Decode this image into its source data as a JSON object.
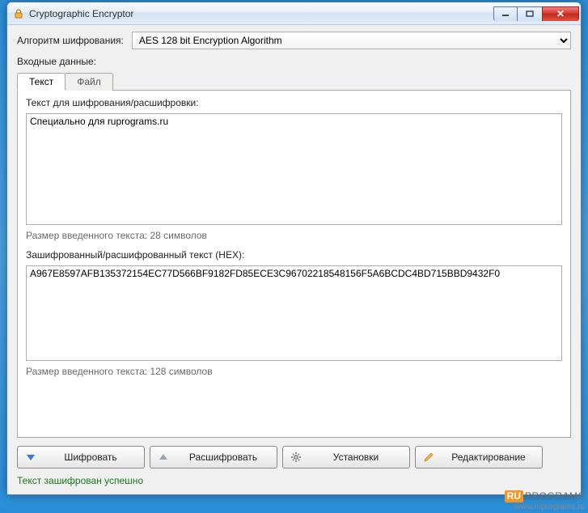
{
  "window": {
    "title": "Cryptographic Encryptor"
  },
  "form": {
    "algorithm_label": "Алгоритм шифрования:",
    "algorithm_value": "AES 128 bit Encryption Algorithm",
    "input_label": "Входные данные:"
  },
  "tabs": {
    "text": "Текст",
    "file": "Файл"
  },
  "plain": {
    "label": "Текст для шифрования/расшифровки:",
    "value": "Специально для ruprograms.ru",
    "size": "Размер введенного текста: 28 символов"
  },
  "hex": {
    "label": "Зашифрованный/расшифрованный текст (HEX):",
    "value": "A967E8597AFB135372154EC77D566BF9182FD85ECE3C96702218548156F5A6BCDC4BD715BBD9432F0",
    "size": "Размер введенного текста: 128 символов"
  },
  "buttons": {
    "encrypt": "Шифровать",
    "decrypt": "Расшифровать",
    "settings": "Установки",
    "edit": "Редактирование"
  },
  "status": "Текст зашифрован успешно",
  "brand": {
    "ru": "RU",
    "programs": "PROGRAMS",
    "url": "www.ruprograms.ru"
  }
}
